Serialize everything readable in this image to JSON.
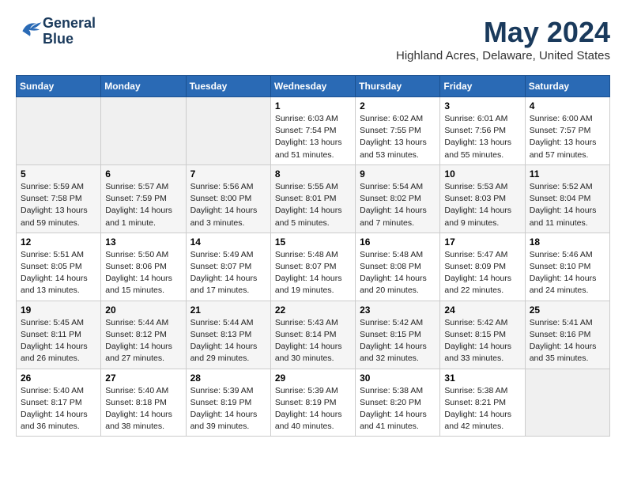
{
  "header": {
    "logo_line1": "General",
    "logo_line2": "Blue",
    "main_title": "May 2024",
    "subtitle": "Highland Acres, Delaware, United States"
  },
  "days_of_week": [
    "Sunday",
    "Monday",
    "Tuesday",
    "Wednesday",
    "Thursday",
    "Friday",
    "Saturday"
  ],
  "weeks": [
    [
      {
        "day": "",
        "info": ""
      },
      {
        "day": "",
        "info": ""
      },
      {
        "day": "",
        "info": ""
      },
      {
        "day": "1",
        "info": "Sunrise: 6:03 AM\nSunset: 7:54 PM\nDaylight: 13 hours\nand 51 minutes."
      },
      {
        "day": "2",
        "info": "Sunrise: 6:02 AM\nSunset: 7:55 PM\nDaylight: 13 hours\nand 53 minutes."
      },
      {
        "day": "3",
        "info": "Sunrise: 6:01 AM\nSunset: 7:56 PM\nDaylight: 13 hours\nand 55 minutes."
      },
      {
        "day": "4",
        "info": "Sunrise: 6:00 AM\nSunset: 7:57 PM\nDaylight: 13 hours\nand 57 minutes."
      }
    ],
    [
      {
        "day": "5",
        "info": "Sunrise: 5:59 AM\nSunset: 7:58 PM\nDaylight: 13 hours\nand 59 minutes."
      },
      {
        "day": "6",
        "info": "Sunrise: 5:57 AM\nSunset: 7:59 PM\nDaylight: 14 hours\nand 1 minute."
      },
      {
        "day": "7",
        "info": "Sunrise: 5:56 AM\nSunset: 8:00 PM\nDaylight: 14 hours\nand 3 minutes."
      },
      {
        "day": "8",
        "info": "Sunrise: 5:55 AM\nSunset: 8:01 PM\nDaylight: 14 hours\nand 5 minutes."
      },
      {
        "day": "9",
        "info": "Sunrise: 5:54 AM\nSunset: 8:02 PM\nDaylight: 14 hours\nand 7 minutes."
      },
      {
        "day": "10",
        "info": "Sunrise: 5:53 AM\nSunset: 8:03 PM\nDaylight: 14 hours\nand 9 minutes."
      },
      {
        "day": "11",
        "info": "Sunrise: 5:52 AM\nSunset: 8:04 PM\nDaylight: 14 hours\nand 11 minutes."
      }
    ],
    [
      {
        "day": "12",
        "info": "Sunrise: 5:51 AM\nSunset: 8:05 PM\nDaylight: 14 hours\nand 13 minutes."
      },
      {
        "day": "13",
        "info": "Sunrise: 5:50 AM\nSunset: 8:06 PM\nDaylight: 14 hours\nand 15 minutes."
      },
      {
        "day": "14",
        "info": "Sunrise: 5:49 AM\nSunset: 8:07 PM\nDaylight: 14 hours\nand 17 minutes."
      },
      {
        "day": "15",
        "info": "Sunrise: 5:48 AM\nSunset: 8:07 PM\nDaylight: 14 hours\nand 19 minutes."
      },
      {
        "day": "16",
        "info": "Sunrise: 5:48 AM\nSunset: 8:08 PM\nDaylight: 14 hours\nand 20 minutes."
      },
      {
        "day": "17",
        "info": "Sunrise: 5:47 AM\nSunset: 8:09 PM\nDaylight: 14 hours\nand 22 minutes."
      },
      {
        "day": "18",
        "info": "Sunrise: 5:46 AM\nSunset: 8:10 PM\nDaylight: 14 hours\nand 24 minutes."
      }
    ],
    [
      {
        "day": "19",
        "info": "Sunrise: 5:45 AM\nSunset: 8:11 PM\nDaylight: 14 hours\nand 26 minutes."
      },
      {
        "day": "20",
        "info": "Sunrise: 5:44 AM\nSunset: 8:12 PM\nDaylight: 14 hours\nand 27 minutes."
      },
      {
        "day": "21",
        "info": "Sunrise: 5:44 AM\nSunset: 8:13 PM\nDaylight: 14 hours\nand 29 minutes."
      },
      {
        "day": "22",
        "info": "Sunrise: 5:43 AM\nSunset: 8:14 PM\nDaylight: 14 hours\nand 30 minutes."
      },
      {
        "day": "23",
        "info": "Sunrise: 5:42 AM\nSunset: 8:15 PM\nDaylight: 14 hours\nand 32 minutes."
      },
      {
        "day": "24",
        "info": "Sunrise: 5:42 AM\nSunset: 8:15 PM\nDaylight: 14 hours\nand 33 minutes."
      },
      {
        "day": "25",
        "info": "Sunrise: 5:41 AM\nSunset: 8:16 PM\nDaylight: 14 hours\nand 35 minutes."
      }
    ],
    [
      {
        "day": "26",
        "info": "Sunrise: 5:40 AM\nSunset: 8:17 PM\nDaylight: 14 hours\nand 36 minutes."
      },
      {
        "day": "27",
        "info": "Sunrise: 5:40 AM\nSunset: 8:18 PM\nDaylight: 14 hours\nand 38 minutes."
      },
      {
        "day": "28",
        "info": "Sunrise: 5:39 AM\nSunset: 8:19 PM\nDaylight: 14 hours\nand 39 minutes."
      },
      {
        "day": "29",
        "info": "Sunrise: 5:39 AM\nSunset: 8:19 PM\nDaylight: 14 hours\nand 40 minutes."
      },
      {
        "day": "30",
        "info": "Sunrise: 5:38 AM\nSunset: 8:20 PM\nDaylight: 14 hours\nand 41 minutes."
      },
      {
        "day": "31",
        "info": "Sunrise: 5:38 AM\nSunset: 8:21 PM\nDaylight: 14 hours\nand 42 minutes."
      },
      {
        "day": "",
        "info": ""
      }
    ]
  ]
}
